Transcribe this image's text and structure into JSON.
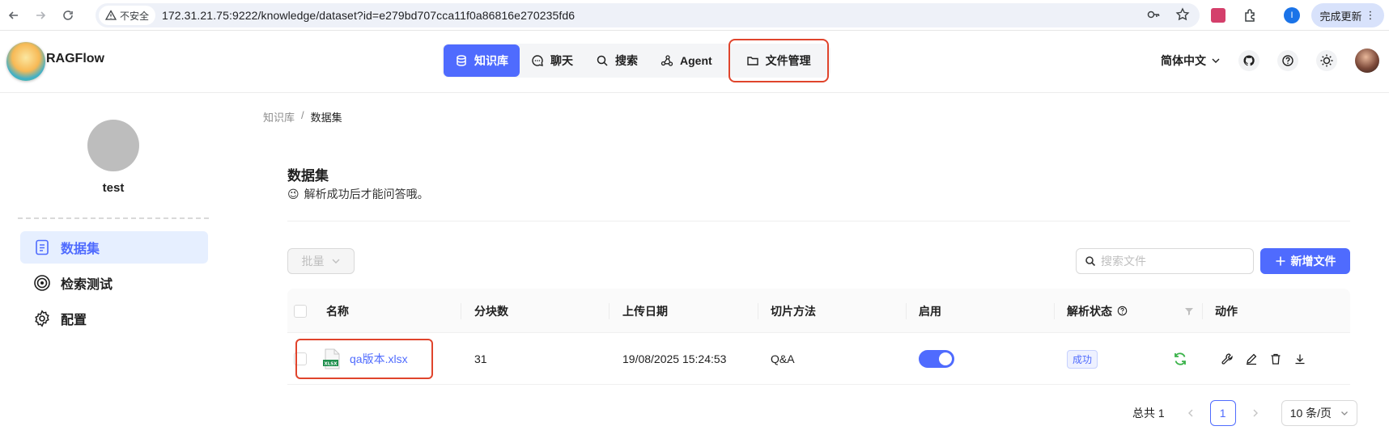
{
  "browser": {
    "insecure_label": "不安全",
    "url": "172.31.21.75:9222/knowledge/dataset?id=e279bd707cca11f0a86816e270235fd6",
    "update_label": "完成更新",
    "profile_initial": "I"
  },
  "header": {
    "brand": "RAGFlow",
    "nav": [
      {
        "label": "知识库",
        "icon": "database-icon"
      },
      {
        "label": "聊天",
        "icon": "chat-icon"
      },
      {
        "label": "搜索",
        "icon": "search-icon"
      },
      {
        "label": "Agent",
        "icon": "agent-icon"
      },
      {
        "label": "文件管理",
        "icon": "folder-icon"
      }
    ],
    "language": "简体中文"
  },
  "sidebar": {
    "kb_name": "test",
    "items": [
      {
        "label": "数据集",
        "icon": "document-icon"
      },
      {
        "label": "检索测试",
        "icon": "target-icon"
      },
      {
        "label": "配置",
        "icon": "gear-icon"
      }
    ]
  },
  "breadcrumb": {
    "parent": "知识库",
    "separator": "/",
    "current": "数据集"
  },
  "main": {
    "title": "数据集",
    "tip": "解析成功后才能问答哦。",
    "tip_emoji": "😉",
    "bulk_label": "批量",
    "search_placeholder": "搜索文件",
    "add_label": "新增文件"
  },
  "table": {
    "columns": [
      "名称",
      "分块数",
      "上传日期",
      "切片方法",
      "启用",
      "解析状态",
      "动作"
    ],
    "rows": [
      {
        "file_name": "qa版本.xlsx",
        "file_type": "XLSX",
        "chunks": "31",
        "upload_date": "19/08/2025 15:24:53",
        "parser": "Q&A",
        "enabled": true,
        "status": "成功"
      }
    ]
  },
  "pagination": {
    "total": "总共 1",
    "current_page": "1",
    "page_size": "10 条/页"
  },
  "colors": {
    "accent": "#4f6bfe",
    "highlight": "#e0442c",
    "success": "#3bb34a"
  }
}
